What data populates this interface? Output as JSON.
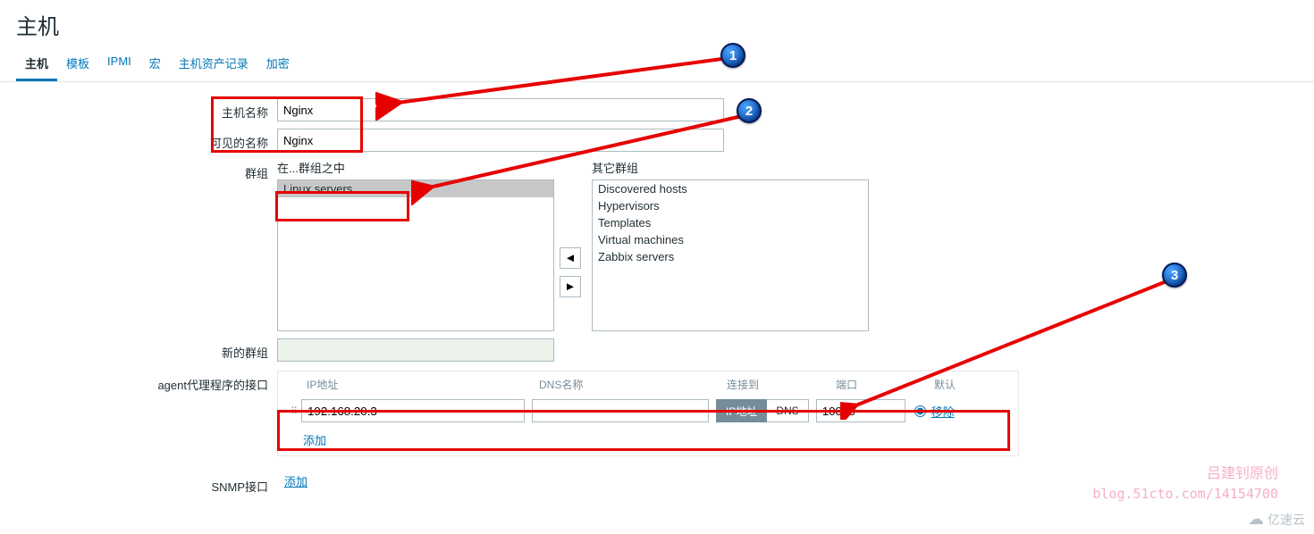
{
  "title": "主机",
  "tabs": [
    "主机",
    "模板",
    "IPMI",
    "宏",
    "主机资产记录",
    "加密"
  ],
  "form": {
    "hostname_label": "主机名称",
    "hostname_value": "Nginx",
    "visiblename_label": "可见的名称",
    "visiblename_value": "Nginx",
    "groups_label": "群组",
    "in_groups_header": "在...群组之中",
    "other_groups_header": "其它群组",
    "in_groups": [
      "Linux servers"
    ],
    "other_groups": [
      "Discovered hosts",
      "Hypervisors",
      "Templates",
      "Virtual machines",
      "Zabbix servers"
    ],
    "newgroup_label": "新的群组",
    "newgroup_value": ""
  },
  "agent": {
    "section_label": "agent代理程序的接口",
    "headers": {
      "ip": "IP地址",
      "dns": "DNS名称",
      "connect": "连接到",
      "port": "端口",
      "default": "默认"
    },
    "row": {
      "ip": "192.168.20.3",
      "dns": "",
      "seg_ip": "IP地址",
      "seg_dns": "DNS",
      "port": "10050",
      "remove": "移除"
    },
    "add": "添加"
  },
  "snmp": {
    "label": "SNMP接口",
    "add": "添加"
  },
  "callouts": {
    "c1": "1",
    "c2": "2",
    "c3": "3"
  },
  "watermark": {
    "line1": "吕建钊原创",
    "line2": "blog.51cto.com/14154700",
    "brand": "亿速云"
  }
}
